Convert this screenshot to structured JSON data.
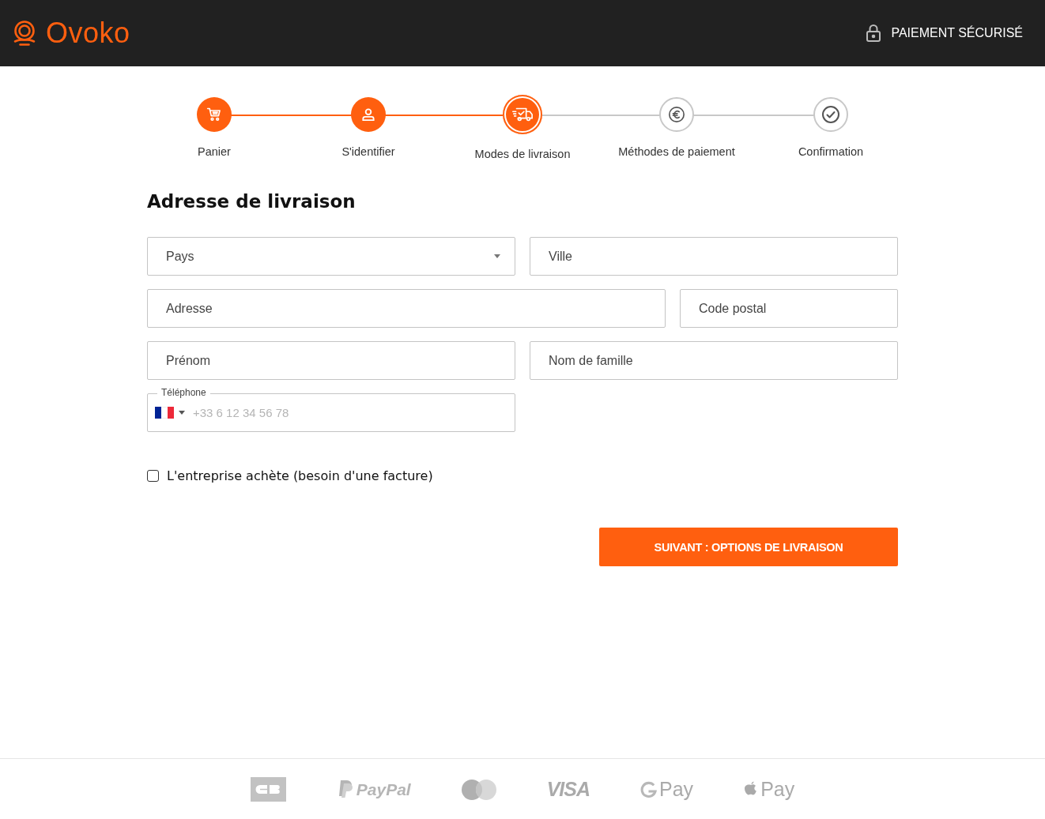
{
  "header": {
    "brand": "Ovoko",
    "secure_label": "PAIEMENT SÉCURISÉ"
  },
  "steps": [
    {
      "label": "Panier",
      "kind": "cart",
      "completed": true,
      "selected": false
    },
    {
      "label": "S'identifier",
      "kind": "user",
      "completed": true,
      "selected": false
    },
    {
      "label": "Modes de livraison",
      "kind": "truck",
      "completed": false,
      "selected": true
    },
    {
      "label": "Méthodes de paiement",
      "kind": "euro",
      "completed": false,
      "selected": false
    },
    {
      "label": "Confirmation",
      "kind": "check",
      "completed": false,
      "selected": false
    }
  ],
  "form": {
    "title": "Adresse de livraison",
    "rows": [
      [
        {
          "kind": "select",
          "placeholder": "Pays"
        },
        {
          "kind": "text",
          "placeholder": "Ville"
        }
      ],
      [
        {
          "kind": "text",
          "placeholder": "Adresse"
        },
        {
          "kind": "text",
          "placeholder": "Code postal"
        }
      ],
      [
        {
          "kind": "text",
          "placeholder": "Prénom"
        },
        {
          "kind": "text",
          "placeholder": "Nom de famille"
        }
      ],
      [
        {
          "kind": "phone",
          "label": "Téléphone",
          "placeholder": "+33 6 12 34 56 78"
        }
      ]
    ],
    "company_checkbox": {
      "label": "L'entreprise achète (besoin d'une facture)",
      "checked": false
    },
    "next_button": "SUIVANT : OPTIONS DE LIVRAISON"
  },
  "payment_logos": [
    {
      "kind": "cb"
    },
    {
      "kind": "paypal",
      "text": "PayPal"
    },
    {
      "kind": "mastercard"
    },
    {
      "kind": "visa",
      "text": "VISA"
    },
    {
      "kind": "gpay",
      "text": "Pay"
    },
    {
      "kind": "applepay",
      "text": "Pay"
    }
  ]
}
